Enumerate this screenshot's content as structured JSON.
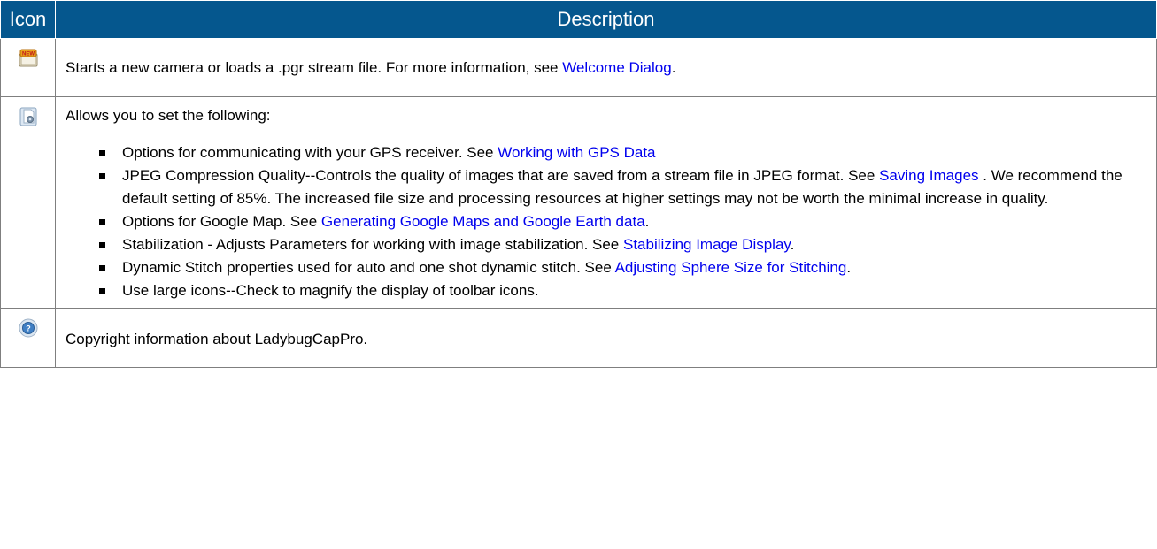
{
  "table": {
    "headers": {
      "icon": "Icon",
      "description": "Description"
    },
    "rows": [
      {
        "icon": "new-stream-icon",
        "parts": [
          {
            "text": "Starts a new camera or loads a .pgr stream file.  For more information, see "
          },
          {
            "link": "Welcome Dialog"
          },
          {
            "text": "."
          }
        ]
      },
      {
        "icon": "settings-document-icon",
        "intro": "Allows you to set the following:",
        "items": [
          [
            {
              "text": "Options for communicating with your GPS receiver. See "
            },
            {
              "link": "Working with GPS Data"
            }
          ],
          [
            {
              "text": "JPEG Compression Quality--Controls the quality of images that are saved from a stream file in JPEG format. See "
            },
            {
              "link": "Saving Images"
            },
            {
              "text": " . We recommend the default setting of 85%. The increased file size and processing resources at higher settings may not be worth the minimal increase in quality."
            }
          ],
          [
            {
              "text": "Options for Google Map. See "
            },
            {
              "link": "Generating Google Maps and Google Earth data"
            },
            {
              "text": "."
            }
          ],
          [
            {
              "text": "Stabilization - Adjusts Parameters for working with image stabilization. See "
            },
            {
              "link": "Stabilizing Image Display"
            },
            {
              "text": "."
            }
          ],
          [
            {
              "text": "Dynamic Stitch properties used for auto and one shot dynamic stitch. See "
            },
            {
              "link": "Adjusting Sphere Size for Stitching"
            },
            {
              "text": "."
            }
          ],
          [
            {
              "text": "Use large icons--Check to magnify the display of toolbar icons."
            }
          ]
        ]
      },
      {
        "icon": "about-info-icon",
        "parts": [
          {
            "text": "Copyright information about LadybugCapPro."
          }
        ]
      }
    ]
  },
  "colors": {
    "header_bg": "#05578e",
    "link": "#0000ee",
    "border": "#7f7f7f"
  }
}
